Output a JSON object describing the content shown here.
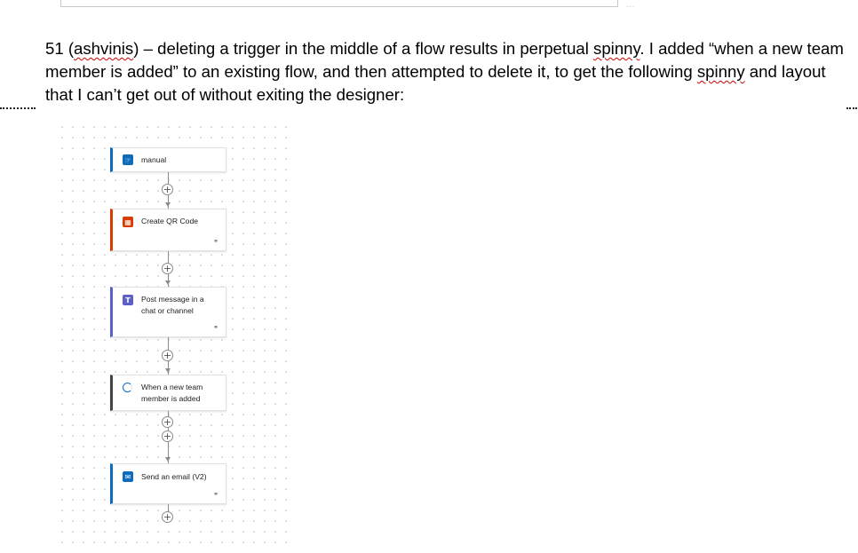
{
  "document": {
    "top_dots": "…",
    "paragraph": {
      "part1": "51 (",
      "user": "ashvinis",
      "part2": ") – deleting a trigger in the middle of a flow results in perpetual ",
      "word_spinny1": "spinny",
      "part3": ". I added “when a new team member is added” to an existing flow, and then attempted to delete it, to get the following ",
      "word_spinny2": "spinny",
      "part4": " and layout that I can’t get out of without exiting the designer:"
    }
  },
  "flow": {
    "steps": [
      {
        "title": "manual",
        "icon": "manual-trigger-icon",
        "accent": "#0f6cbd",
        "icon_color": "#0f6cbd"
      },
      {
        "title": "Create QR Code",
        "icon": "qr-code-icon",
        "accent": "#d83b01",
        "icon_color": "#d83b01"
      },
      {
        "title": "Post message in a chat or channel",
        "icon": "teams-icon",
        "accent": "#5b5fc7",
        "icon_color": "#5b5fc7"
      },
      {
        "title": "When a new team member is added",
        "icon": "loading-spinner-icon",
        "accent": "#444444",
        "icon_color": "#0f6cbd"
      },
      {
        "title": "Send an email (V2)",
        "icon": "outlook-icon",
        "accent": "#0f6cbd",
        "icon_color": "#0f6cbd"
      }
    ],
    "add_symbol": "+",
    "link_symbol": "⚭"
  }
}
